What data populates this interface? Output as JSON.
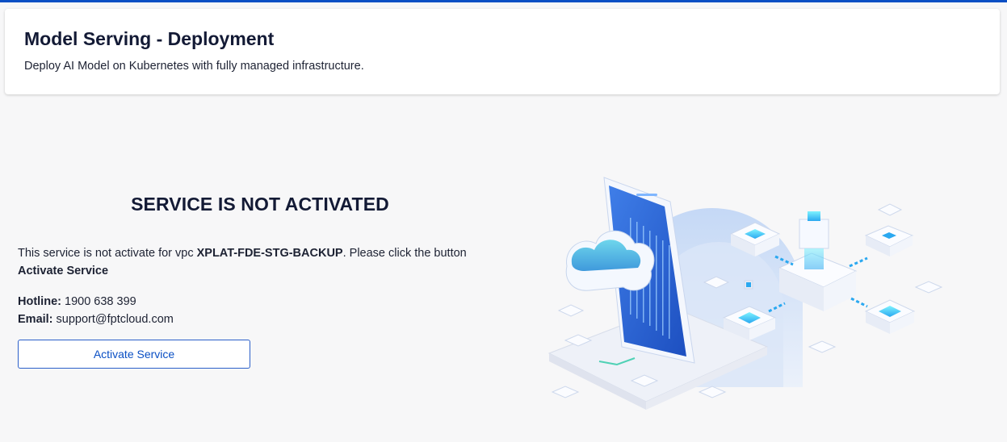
{
  "header": {
    "title": "Model Serving - Deployment",
    "subtitle": "Deploy AI Model on Kubernetes with fully managed infrastructure."
  },
  "status": {
    "heading": "SERVICE IS NOT ACTIVATED",
    "message_prefix": "This service is not activate for vpc ",
    "vpc_name": "XPLAT-FDE-STG-BACKUP",
    "message_middle": ". Please click the button ",
    "message_action": "Activate Service"
  },
  "contact": {
    "hotline_label": "Hotline:",
    "hotline_value": "1900 638 399",
    "email_label": "Email:",
    "email_value": "support@fptcloud.com"
  },
  "actions": {
    "activate_label": "Activate Service"
  },
  "colors": {
    "accent": "#0a4fc4",
    "title": "#131a35",
    "background": "#f7f7f8"
  },
  "illustration": {
    "icon": "cloud-server-network-illustration"
  }
}
